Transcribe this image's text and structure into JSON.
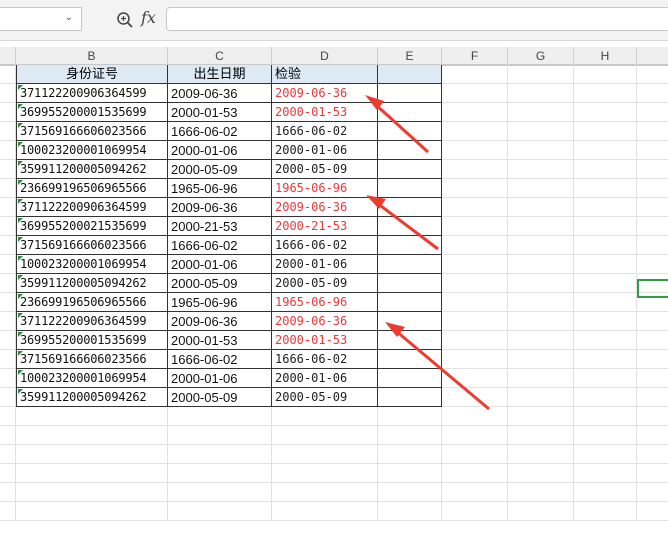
{
  "formula_bar": {
    "name_box_value": "",
    "fx_label": "fx",
    "formula_value": ""
  },
  "columns": [
    "B",
    "C",
    "D",
    "E",
    "F",
    "G",
    "H"
  ],
  "table": {
    "headers": [
      "身份证号",
      "出生日期",
      "检验"
    ],
    "rows": [
      {
        "id": "371122200906364599",
        "birth": "2009-06-36",
        "check": "2009-06-36",
        "flag": true
      },
      {
        "id": "369955200001535699",
        "birth": "2000-01-53",
        "check": "2000-01-53",
        "flag": true
      },
      {
        "id": "371569166606023566",
        "birth": "1666-06-02",
        "check": "1666-06-02",
        "flag": false
      },
      {
        "id": "100023200001069954",
        "birth": "2000-01-06",
        "check": "2000-01-06",
        "flag": false
      },
      {
        "id": "359911200005094262",
        "birth": "2000-05-09",
        "check": "2000-05-09",
        "flag": false
      },
      {
        "id": "236699196506965566",
        "birth": "1965-06-96",
        "check": "1965-06-96",
        "flag": true
      },
      {
        "id": "371122200906364599",
        "birth": "2009-06-36",
        "check": "2009-06-36",
        "flag": true
      },
      {
        "id": "369955200021535699",
        "birth": "2000-21-53",
        "check": "2000-21-53",
        "flag": true
      },
      {
        "id": "371569166606023566",
        "birth": "1666-06-02",
        "check": "1666-06-02",
        "flag": false
      },
      {
        "id": "100023200001069954",
        "birth": "2000-01-06",
        "check": "2000-01-06",
        "flag": false
      },
      {
        "id": "359911200005094262",
        "birth": "2000-05-09",
        "check": "2000-05-09",
        "flag": false
      },
      {
        "id": "236699196506965566",
        "birth": "1965-06-96",
        "check": "1965-06-96",
        "flag": true
      },
      {
        "id": "371122200906364599",
        "birth": "2009-06-36",
        "check": "2009-06-36",
        "flag": true
      },
      {
        "id": "369955200001535699",
        "birth": "2000-01-53",
        "check": "2000-01-53",
        "flag": true
      },
      {
        "id": "371569166606023566",
        "birth": "1666-06-02",
        "check": "1666-06-02",
        "flag": false
      },
      {
        "id": "100023200001069954",
        "birth": "2000-01-06",
        "check": "2000-01-06",
        "flag": false
      },
      {
        "id": "359911200005094262",
        "birth": "2000-05-09",
        "check": "2000-05-09",
        "flag": false
      }
    ]
  },
  "colors": {
    "invalid_text": "#e83a3a",
    "header_fill": "#dde9f5",
    "selection": "#2e9e44",
    "arrow": "#ee3b2f"
  }
}
